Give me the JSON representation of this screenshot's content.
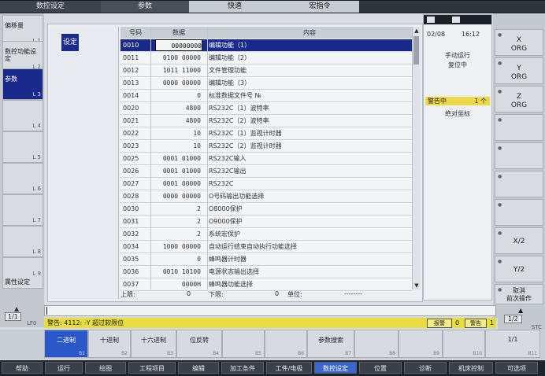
{
  "tabs": [
    "数控设定",
    "参数",
    "快速",
    "宏指令"
  ],
  "left_buttons": [
    {
      "label": "偏移量",
      "num": "L 1"
    },
    {
      "label": "数控功能设定",
      "num": "L 2"
    },
    {
      "label": "参数",
      "num": "L 3"
    },
    {
      "label": "",
      "num": "L 4"
    },
    {
      "label": "",
      "num": "L 5"
    },
    {
      "label": "",
      "num": "L 6"
    },
    {
      "label": "",
      "num": "L 7"
    },
    {
      "label": "",
      "num": "L 8"
    },
    {
      "label": "属性设定",
      "num": "L 9"
    }
  ],
  "main": {
    "set_button": "设定",
    "columns": {
      "no": "号码",
      "data": "数据",
      "content": "内容"
    },
    "rows": [
      {
        "no": "0010",
        "data": "00000000",
        "content": "编辑功能（1）"
      },
      {
        "no": "0011",
        "data": "0100 00000",
        "content": "编辑功能（2）"
      },
      {
        "no": "0012",
        "data": "1011 11000",
        "content": "文件管理功能"
      },
      {
        "no": "0013",
        "data": "0000 00000",
        "content": "编辑功能（3）"
      },
      {
        "no": "0014",
        "data": "0",
        "content": "标准数据文件号 №"
      },
      {
        "no": "0020",
        "data": "4800",
        "content": "RS232C（1）波特率"
      },
      {
        "no": "0021",
        "data": "4800",
        "content": "RS232C（2）波特率"
      },
      {
        "no": "0022",
        "data": "10",
        "content": "RS232C（1）监视计时器"
      },
      {
        "no": "0023",
        "data": "10",
        "content": "RS232C（2）监视计时器"
      },
      {
        "no": "0025",
        "data": "0001 01000",
        "content": "RS232C输入"
      },
      {
        "no": "0026",
        "data": "0001 01000",
        "content": "RS232C输出"
      },
      {
        "no": "0027",
        "data": "0001 00000",
        "content": "RS232C"
      },
      {
        "no": "0028",
        "data": "0000 00000",
        "content": "O号码输出功能选择"
      },
      {
        "no": "0030",
        "data": "2",
        "content": "O8000保护"
      },
      {
        "no": "0031",
        "data": "2",
        "content": "O9000保护"
      },
      {
        "no": "0032",
        "data": "2",
        "content": "系统宏保护"
      },
      {
        "no": "0034",
        "data": "1000 00000",
        "content": "自动运行结束自动执行功能选择"
      },
      {
        "no": "0035",
        "data": "0",
        "content": "蜂鸣器计时器"
      },
      {
        "no": "0036",
        "data": "0010 10100",
        "content": "电源状态输出选择"
      },
      {
        "no": "0037",
        "data": "0000H",
        "content": "蜂鸣器功能选择"
      }
    ],
    "limits": {
      "upper_label": "上限:",
      "upper_value": "0",
      "lower_label": "下限:",
      "lower_value": "0",
      "unit_label": "单位:",
      "unit_value": "--------"
    }
  },
  "info": {
    "date": "02/08",
    "time": "16:12",
    "status1": "手动运行",
    "status2": "复位中",
    "alarm_label": "警告中",
    "alarm_count": "1 个",
    "coord": "绝对坐标"
  },
  "right_buttons": [
    {
      "label": "X\nORG"
    },
    {
      "label": "Y\nORG"
    },
    {
      "label": "Z\nORG"
    },
    {
      "label": ""
    },
    {
      "label": ""
    },
    {
      "label": ""
    },
    {
      "label": ""
    },
    {
      "label": "X/2"
    },
    {
      "label": "Y/2"
    },
    {
      "label": "取消\n前次操作"
    }
  ],
  "alarm_bar": {
    "message": "警告: 4112: -Y 超过软限位",
    "btn1": "报警",
    "n1": "0",
    "btn2": "警告",
    "n2": "1"
  },
  "page_left": {
    "page": "1/1",
    "lf": "LF0"
  },
  "page_right": {
    "page": "1/2",
    "stc": "STC"
  },
  "softkeys": [
    {
      "label": "二进制",
      "num": "B1"
    },
    {
      "label": "十进制",
      "num": "B2"
    },
    {
      "label": "十六进制",
      "num": "B3"
    },
    {
      "label": "位反转",
      "num": "B4"
    },
    {
      "label": "",
      "num": "B5"
    },
    {
      "label": "",
      "num": "B6"
    },
    {
      "label": "参数搜索",
      "num": "B7"
    },
    {
      "label": "",
      "num": "B8"
    },
    {
      "label": "",
      "num": "B9"
    },
    {
      "label": "",
      "num": "B10"
    },
    {
      "label": "1/1",
      "num": "B11"
    }
  ],
  "menu": [
    "帮助",
    "运行",
    "绘图",
    "工程项目",
    "编辑",
    "加工条件",
    "工件/电极",
    "数控设定",
    "位置",
    "诊断",
    "机床控制",
    "可选项"
  ]
}
